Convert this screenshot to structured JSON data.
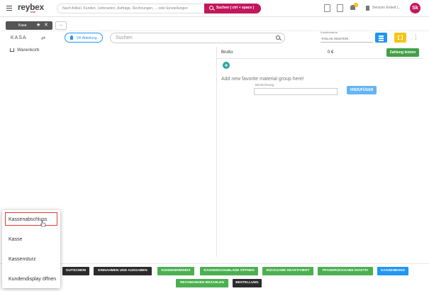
{
  "header": {
    "logo": "reybex",
    "logo_sub": "one",
    "search_placeholder": "Nach Artikel, Kunden, Lieferanten, Aufträge, Rechnungen, ... oder Einstellungen",
    "search_button": "Suchen ( ctrl + space )",
    "notification_count": "3",
    "user_name": "Sencion Enkelt (...",
    "avatar_initials": "Sk"
  },
  "tabs": {
    "active_tab": "Kasa",
    "more": "..."
  },
  "toolbar": {
    "kasa_label": "KASA",
    "vk_button": "VK Abteilung",
    "search_placeholder": "Suchen",
    "kundenname_label": "Kundenname",
    "kundenname_value": "TASLAK MUSTERI"
  },
  "cart": {
    "label": "Warenkorb"
  },
  "summary": {
    "brutto_label": "Brutto:",
    "brutto_value": "0 €",
    "zahlung_button": "Zahlung leisten",
    "favorite_text": "Add new favorite material group here!",
    "bezeichnung_label": "Bezeichnung",
    "add_button": "HINZUFÜGEN"
  },
  "popup_menu": {
    "items": [
      "Kassenabschluss",
      "Kasse",
      "Kassensturz",
      "Kundendisplay öffnen"
    ],
    "highlighted": "Kassenabschluss"
  },
  "actions": {
    "row1": [
      {
        "label": "GUTSCHEIN",
        "style": "dark"
      },
      {
        "label": "EINNAHMEN UND AUSGABEN",
        "style": "dark"
      },
      {
        "label": "KUNDENHINWEIS",
        "style": "green"
      },
      {
        "label": "KASSENSCHUBLADE ÖFFNEN",
        "style": "green"
      },
      {
        "label": "RÜCKGABE DEAKTIVIERT",
        "style": "green"
      },
      {
        "label": "PFANDRÜCKGABE INAKTIV",
        "style": "green"
      },
      {
        "label": "KASSENBONS",
        "style": "blue"
      }
    ],
    "row2": [
      {
        "label": "RECHNUNGEN BEZAHLEN",
        "style": "green"
      },
      {
        "label": "BESTELLUNG",
        "style": "dark"
      }
    ]
  },
  "colors": {
    "brand": "#c2185b",
    "primary_blue": "#2196f3",
    "success_green": "#4caf50",
    "warning_yellow": "#f5c518",
    "highlight_red": "#e53935"
  }
}
